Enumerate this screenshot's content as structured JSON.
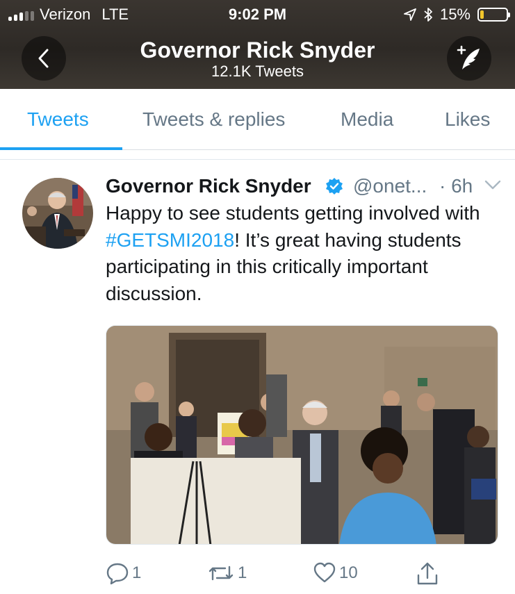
{
  "status_bar": {
    "carrier": "Verizon",
    "network": "LTE",
    "time": "9:02 PM",
    "battery_percent": "15%",
    "battery_level": 0.15
  },
  "header": {
    "title": "Governor Rick Snyder",
    "subtitle": "12.1K Tweets"
  },
  "tabs": [
    {
      "label": "Tweets",
      "active": true
    },
    {
      "label": "Tweets & replies",
      "active": false
    },
    {
      "label": "Media",
      "active": false
    },
    {
      "label": "Likes",
      "active": false
    }
  ],
  "tweet": {
    "author_name": "Governor Rick Snyder",
    "handle": "@onet...",
    "time": "· 6h",
    "text_before": "Happy to see students getting involved with ",
    "hashtag": "#GETSMI2018",
    "text_after": "! It’s great having students participating in this critically important discussion.",
    "reply_count": "1",
    "retweet_count": "1",
    "like_count": "10"
  },
  "colors": {
    "accent": "#1da1f2",
    "secondary_text": "#657786",
    "header_bg": "#2e2a26"
  }
}
